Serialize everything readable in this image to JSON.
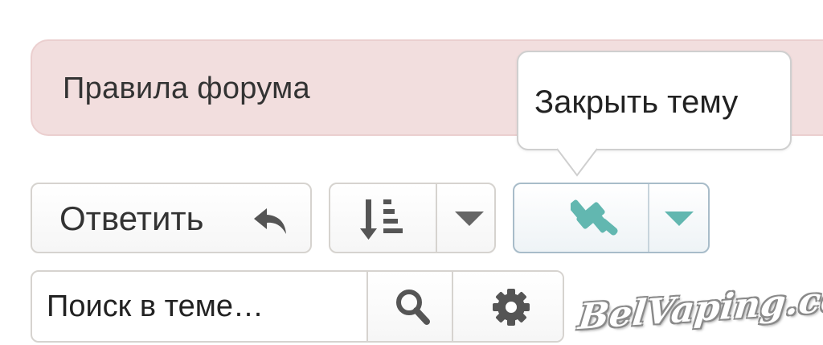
{
  "rules": {
    "text": "Правила форума"
  },
  "tooltip": {
    "text": "Закрыть тему"
  },
  "toolbar": {
    "reply_label": "Ответить",
    "reply_icon": "reply-arrow-icon",
    "sort_icon": "sort-descending-icon",
    "sort_caret_icon": "caret-down-icon",
    "moderation_icon": "gavel-icon",
    "moderation_caret_icon": "caret-down-icon",
    "accent_color": "#62b7b0"
  },
  "search": {
    "placeholder": "Поиск в теме…",
    "search_icon": "magnifier-icon",
    "settings_icon": "gear-icon"
  },
  "watermark": {
    "text": "BelVaping.com"
  },
  "colors": {
    "rules_bg": "#f2dede",
    "border": "#d6d3cf",
    "moderation_border": "#a8bcc9",
    "icon_gray": "#555555"
  }
}
